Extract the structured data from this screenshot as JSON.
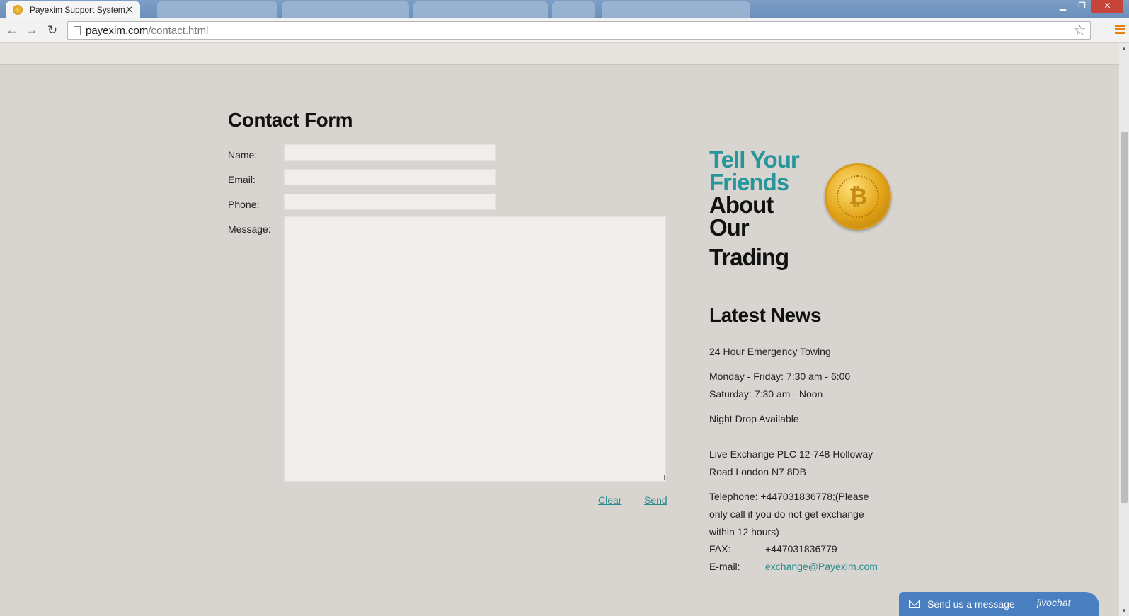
{
  "browser": {
    "active_tab_title": "Payexim Support System,",
    "url_domain": "payexim.com",
    "url_path": "/contact.html"
  },
  "form": {
    "title": "Contact Form",
    "labels": {
      "name": "Name:",
      "email": "Email:",
      "phone": "Phone:",
      "message": "Message:"
    },
    "values": {
      "name": "",
      "email": "",
      "phone": "",
      "message": ""
    },
    "clear_label": "Clear",
    "send_label": "Send"
  },
  "promo": {
    "line1": "Tell Your",
    "line2": "Friends",
    "line3": "About",
    "line4": "Our",
    "line5": "Trading"
  },
  "news": {
    "title": "Latest News",
    "items": [
      "24 Hour Emergency Towing",
      "Monday - Friday: 7:30 am - 6:00",
      "Saturday: 7:30 am - Noon",
      "Night Drop Available",
      "Live Exchange PLC 12-748 Holloway",
      "Road London N7 8DB",
      "Telephone:  +447031836778;(Please",
      "only call if you do not get exchange",
      "within 12 hours)"
    ],
    "fax_label": "FAX:",
    "fax_value": "+447031836779",
    "email_label": "E-mail:",
    "email_value": "exchange@Payexim.com"
  },
  "chat": {
    "label": "Send us a message",
    "brand": "jivochat"
  },
  "icons": {
    "coin": "bitcoin-coin-icon",
    "accent_color": "#27969b"
  }
}
